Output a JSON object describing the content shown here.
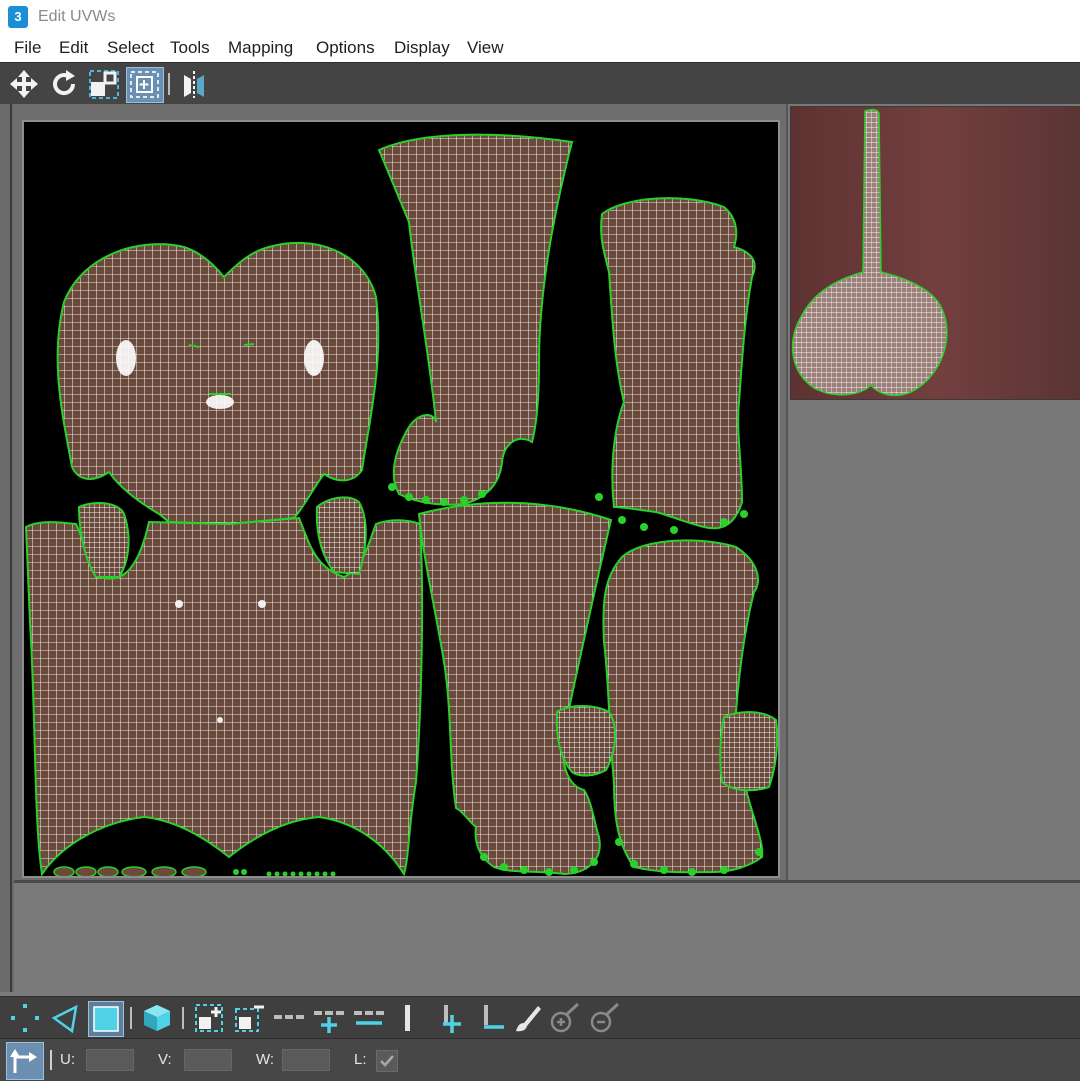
{
  "window": {
    "title": "Edit UVWs",
    "app_icon_label": "3"
  },
  "menu": [
    "File",
    "Edit",
    "Select",
    "Tools",
    "Mapping",
    "Options",
    "Display",
    "View"
  ],
  "toolbar_icons": [
    "move-icon",
    "rotate-icon",
    "scale-icon",
    "freeform-icon",
    "mirror-icon"
  ],
  "bottom_icons": [
    "vertex-select-icon",
    "edge-select-icon",
    "face-select-icon",
    "element-select-icon",
    "grow-selection-icon",
    "shrink-selection-icon",
    "ring-icon",
    "ring-grow-icon",
    "ring-shrink-icon",
    "loop-icon",
    "loop-grow-icon",
    "loop-shrink-icon",
    "paint-select-icon",
    "paint-grow-icon",
    "paint-shrink-icon"
  ],
  "status": {
    "u_label": "U:",
    "v_label": "V:",
    "w_label": "W:",
    "l_label": "L:",
    "l_checked": true
  },
  "colors": {
    "uv_fill": "#6b4a3c",
    "uv_wire": "#e8e8e8",
    "uv_border": "#2bd12b",
    "canvas": "#000000",
    "preview_bg": "#6b3a3a"
  }
}
